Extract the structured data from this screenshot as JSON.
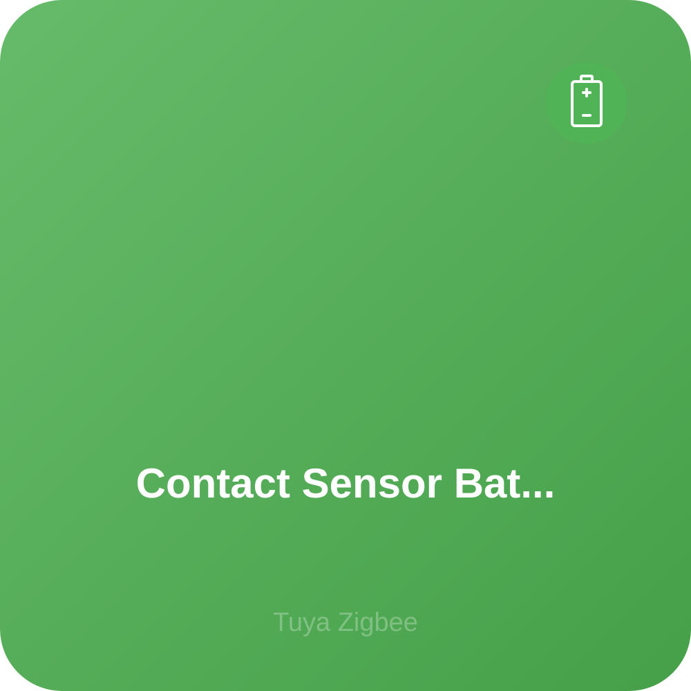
{
  "card": {
    "name": "Contact Sensor Bat...",
    "subtitle": "Tuya Zigbee",
    "icon": "battery-icon",
    "accent_color": "#4caf50"
  }
}
